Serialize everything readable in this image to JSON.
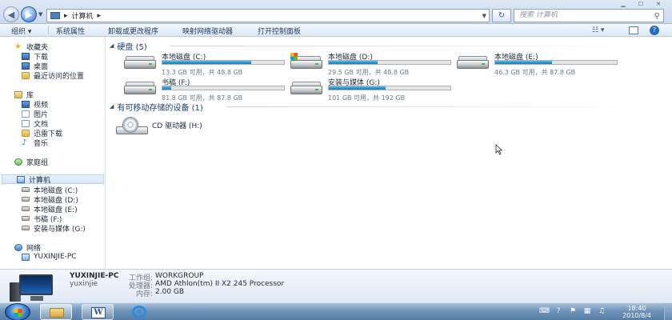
{
  "address": {
    "crumbs": [
      "计算机"
    ],
    "search_placeholder": "搜索 计算机"
  },
  "toolbar": {
    "organize": "组织 ▾",
    "system_properties": "系统属性",
    "uninstall": "卸载或更改程序",
    "map_drive": "映射网络驱动器",
    "control_panel": "打开控制面板"
  },
  "nav": {
    "favorites": "收藏夹",
    "downloads": "下载",
    "desktop": "桌面",
    "recent": "最近访问的位置",
    "libraries": "库",
    "videos": "视频",
    "pictures": "图片",
    "documents": "文档",
    "thunder": "迅雷下载",
    "music": "音乐",
    "homegroup": "家庭组",
    "computer": "计算机",
    "drives": [
      "本地磁盘 (C:)",
      "本地磁盘 (D:)",
      "本地磁盘 (E:)",
      "书稿 (F:)",
      "安装与媒体 (G:)"
    ],
    "network": "网络",
    "network_pc": "YUXINJIE-PC"
  },
  "groups": {
    "hdd": "硬盘 (5)",
    "removable": "有可移动存储的设备 (1)"
  },
  "drives": [
    {
      "name": "本地磁盘 (C:)",
      "free": "13.3 GB 可用，共 48.8 GB",
      "used_fraction": 0.73
    },
    {
      "name": "本地磁盘 (D:)",
      "free": "29.5 GB 可用，共 48.8 GB",
      "used_fraction": 0.4
    },
    {
      "name": "本地磁盘 (E:)",
      "free": "46.3 GB 可用，共 87.8 GB",
      "used_fraction": 0.47
    },
    {
      "name": "书稿 (F:)",
      "free": "81.8 GB 可用，共 87.8 GB",
      "used_fraction": 0.07
    },
    {
      "name": "安装与媒体 (G:)",
      "free": "101 GB 可用，共 192 GB",
      "used_fraction": 0.47
    }
  ],
  "cd": {
    "name": "CD 驱动器 (H:)"
  },
  "details": {
    "pc_name": "YUXINJIE-PC",
    "user": "yuxinjie",
    "workgroup_label": "工作组:",
    "workgroup": "WORKGROUP",
    "cpu_label": "处理器:",
    "cpu": "AMD Athlon(tm) II X2 245 Processor",
    "ram_label": "内存:",
    "ram": "2.00 GB"
  },
  "clock": {
    "time": "18:40",
    "date": "2010/8/4"
  },
  "colors": {
    "bar_fill": "#2694cf",
    "link": "#1e3f7a"
  }
}
